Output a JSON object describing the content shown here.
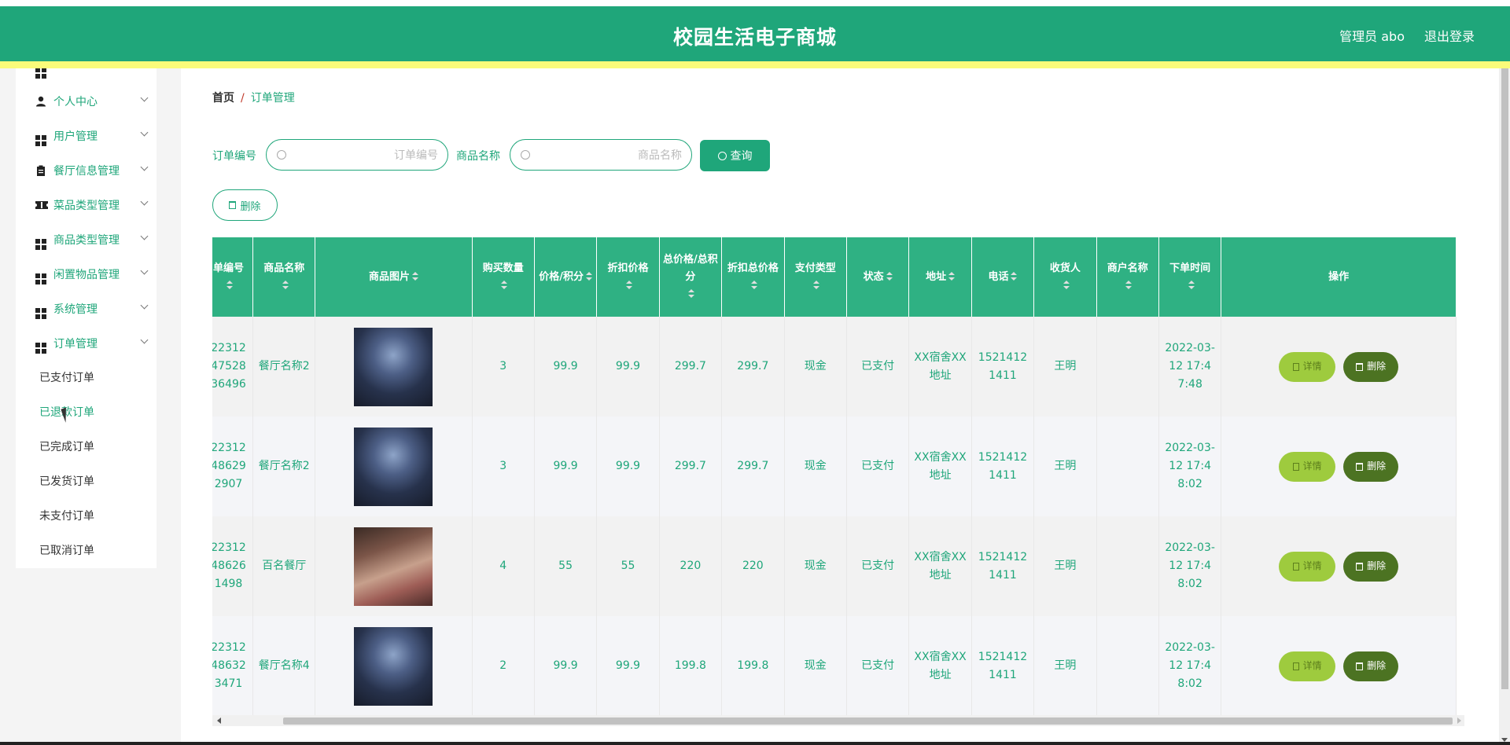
{
  "header": {
    "title": "校园生活电子商城",
    "user": "管理员 abo",
    "logout": "退出登录"
  },
  "sidebar": {
    "items": [
      {
        "label": "个人中心",
        "icon": "person-icon"
      },
      {
        "label": "用户管理",
        "icon": "grid-icon"
      },
      {
        "label": "餐厅信息管理",
        "icon": "clipboard-icon"
      },
      {
        "label": "菜品类型管理",
        "icon": "ticket-icon"
      },
      {
        "label": "商品类型管理",
        "icon": "grid-icon"
      },
      {
        "label": "闲置物品管理",
        "icon": "grid-icon"
      },
      {
        "label": "系统管理",
        "icon": "grid-icon"
      },
      {
        "label": "订单管理",
        "icon": "grid-icon"
      }
    ],
    "subitems": [
      {
        "label": "已支付订单"
      },
      {
        "label": "已退款订单"
      },
      {
        "label": "已完成订单"
      },
      {
        "label": "已发货订单"
      },
      {
        "label": "未支付订单"
      },
      {
        "label": "已取消订单"
      }
    ]
  },
  "breadcrumb": {
    "home": "首页",
    "separator": "/",
    "current": "订单管理"
  },
  "search": {
    "order_no_label": "订单编号",
    "order_no_placeholder": "订单编号",
    "product_label": "商品名称",
    "product_placeholder": "商品名称",
    "query_label": "查询"
  },
  "toolbar": {
    "delete_label": "删除"
  },
  "table": {
    "headers": {
      "order_no": "单编号",
      "product_name": "商品名称",
      "image": "商品图片",
      "quantity": "购买数量",
      "price": "价格/积分",
      "discount_price": "折扣价格",
      "total": "总价格/总积分",
      "discount_total": "折扣总价格",
      "pay_type": "支付类型",
      "status": "状态",
      "address": "地址",
      "phone": "电话",
      "receiver": "收货人",
      "merchant": "商户名称",
      "order_time": "下单时间",
      "actions": "操作"
    },
    "rows": [
      {
        "order_no": "2231247528 36496",
        "product_name": "餐厅名称2",
        "image": "restaurant-photo-dark",
        "quantity": "3",
        "price": "99.9",
        "discount_price": "99.9",
        "total": "299.7",
        "discount_total": "299.7",
        "pay_type": "现金",
        "status": "已支付",
        "address": "XX宿舍XX地址",
        "phone": "15214121411",
        "receiver": "王明",
        "merchant": "",
        "order_time": "2022-03-12 17:47:48"
      },
      {
        "order_no": "22312486292907",
        "product_name": "餐厅名称2",
        "image": "restaurant-photo-dark",
        "quantity": "3",
        "price": "99.9",
        "discount_price": "99.9",
        "total": "299.7",
        "discount_total": "299.7",
        "pay_type": "现金",
        "status": "已支付",
        "address": "XX宿舍XX地址",
        "phone": "15214121411",
        "receiver": "王明",
        "merchant": "",
        "order_time": "2022-03-12 17:48:02"
      },
      {
        "order_no": "22312486261498",
        "product_name": "百名餐厅",
        "image": "restaurant-photo-warm",
        "quantity": "4",
        "price": "55",
        "discount_price": "55",
        "total": "220",
        "discount_total": "220",
        "pay_type": "现金",
        "status": "已支付",
        "address": "XX宿舍XX地址",
        "phone": "15214121411",
        "receiver": "王明",
        "merchant": "",
        "order_time": "2022-03-12 17:48:02"
      },
      {
        "order_no": "22312486323471",
        "product_name": "餐厅名称4",
        "image": "restaurant-photo-dark",
        "quantity": "2",
        "price": "99.9",
        "discount_price": "99.9",
        "total": "199.8",
        "discount_total": "199.8",
        "pay_type": "现金",
        "status": "已支付",
        "address": "XX宿舍XX地址",
        "phone": "15214121411",
        "receiver": "王明",
        "merchant": "",
        "order_time": "2022-03-12 17:48:02"
      }
    ],
    "row_actions": {
      "detail_label": "详情",
      "delete_label": "删除"
    }
  },
  "colors": {
    "primary": "#1fa67a",
    "header_yellow": "#fafb7a",
    "detail_button": "#9ecb3e",
    "delete_button": "#4c7322"
  }
}
